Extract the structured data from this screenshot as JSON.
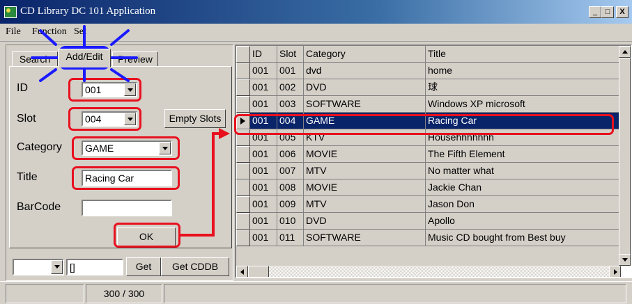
{
  "window": {
    "title": "CD Library DC 101 Application",
    "minimize": "_",
    "maximize": "□",
    "close": "X"
  },
  "menu": [
    "File",
    "Function",
    "Set"
  ],
  "tabs": [
    "Search",
    "Add/Edit",
    "Preview"
  ],
  "form": {
    "id_label": "ID",
    "id_value": "001",
    "slot_label": "Slot",
    "slot_value": "004",
    "empty_slots_button": "Empty Slots",
    "category_label": "Category",
    "category_value": "GAME",
    "title_label": "Title",
    "title_value": "Racing Car",
    "barcode_label": "BarCode",
    "barcode_value": "",
    "ok_button": "OK"
  },
  "bottom_tools": {
    "combo_value": "",
    "text_value": "[]",
    "get_button": "Get",
    "get_cddb_button": "Get CDDB"
  },
  "status": {
    "pane1": "",
    "pane2": "300 / 300",
    "pane3": ""
  },
  "grid": {
    "columns": [
      "ID",
      "Slot",
      "Category",
      "Title"
    ],
    "selected_row": 3,
    "rows": [
      [
        "001",
        "001",
        "dvd",
        "home"
      ],
      [
        "001",
        "002",
        "DVD",
        "球"
      ],
      [
        "001",
        "003",
        "SOFTWARE",
        "Windows XP microsoft"
      ],
      [
        "001",
        "004",
        "GAME",
        "Racing Car"
      ],
      [
        "001",
        "005",
        "KTV",
        "Househhhhhhh"
      ],
      [
        "001",
        "006",
        "MOVIE",
        "The Fifth Element"
      ],
      [
        "001",
        "007",
        "MTV",
        "No matter what"
      ],
      [
        "001",
        "008",
        "MOVIE",
        "Jackie Chan"
      ],
      [
        "001",
        "009",
        "MTV",
        "Jason Don"
      ],
      [
        "001",
        "010",
        "DVD",
        "Apollo"
      ],
      [
        "001",
        "011",
        "SOFTWARE",
        "Music CD bought from Best buy"
      ]
    ]
  },
  "colors": {
    "highlight": "#e8101e",
    "focus_marker": "#1a1aff",
    "selection": "#0a246a",
    "window_bg": "#d4d0c8"
  }
}
